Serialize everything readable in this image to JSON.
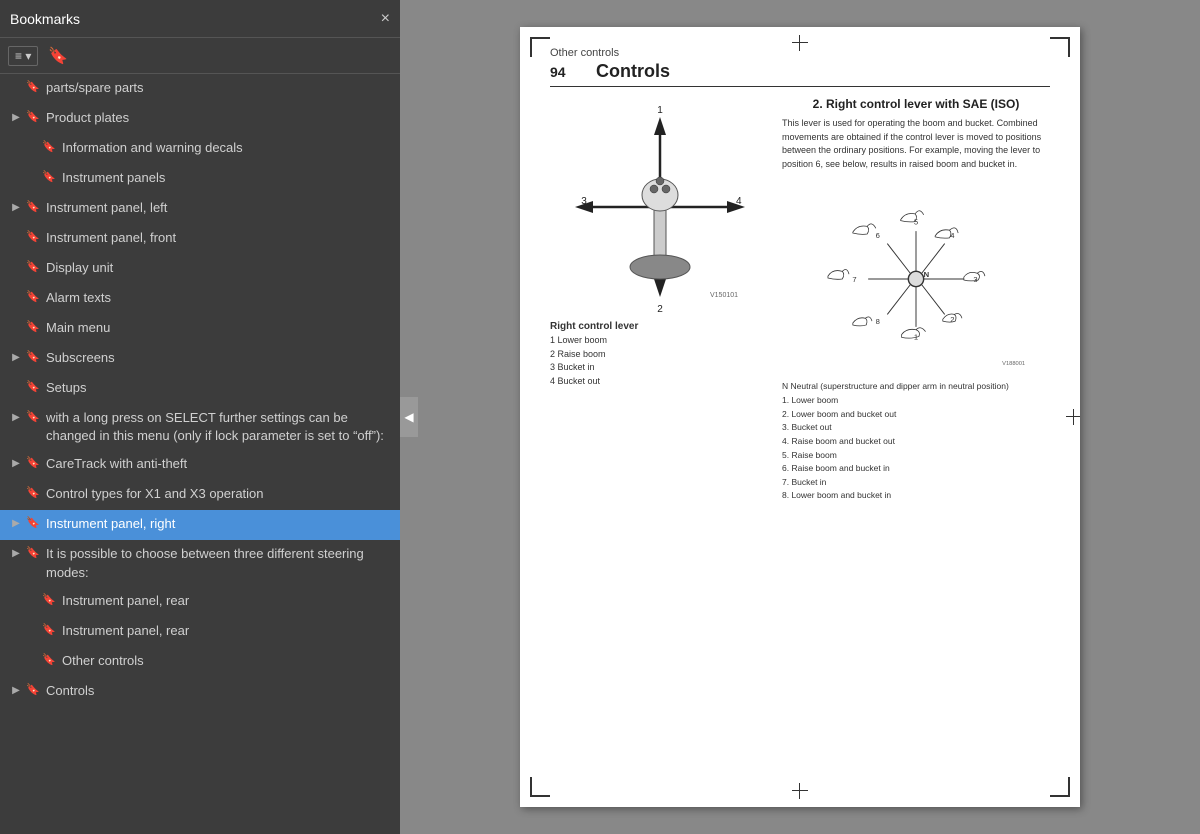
{
  "bookmarks": {
    "title": "Bookmarks",
    "close_label": "×",
    "toolbar": {
      "view_btn": "≡ ▾",
      "bookmark_btn": "🔖"
    },
    "items": [
      {
        "id": 1,
        "label": "parts/spare parts",
        "indent": 0,
        "hasChevron": false,
        "chevronOpen": false,
        "selected": false
      },
      {
        "id": 2,
        "label": "Product plates",
        "indent": 0,
        "hasChevron": true,
        "chevronOpen": false,
        "selected": false
      },
      {
        "id": 3,
        "label": "Information and warning decals",
        "indent": 1,
        "hasChevron": false,
        "chevronOpen": false,
        "selected": false
      },
      {
        "id": 4,
        "label": "Instrument panels",
        "indent": 1,
        "hasChevron": false,
        "chevronOpen": false,
        "selected": false
      },
      {
        "id": 5,
        "label": "Instrument panel, left",
        "indent": 0,
        "hasChevron": true,
        "chevronOpen": false,
        "selected": false
      },
      {
        "id": 6,
        "label": "Instrument panel, front",
        "indent": 0,
        "hasChevron": false,
        "chevronOpen": false,
        "selected": false
      },
      {
        "id": 7,
        "label": "Display unit",
        "indent": 0,
        "hasChevron": false,
        "chevronOpen": false,
        "selected": false
      },
      {
        "id": 8,
        "label": "Alarm texts",
        "indent": 0,
        "hasChevron": false,
        "chevronOpen": false,
        "selected": false
      },
      {
        "id": 9,
        "label": "Main menu",
        "indent": 0,
        "hasChevron": false,
        "chevronOpen": false,
        "selected": false
      },
      {
        "id": 10,
        "label": "Subscreens",
        "indent": 0,
        "hasChevron": true,
        "chevronOpen": false,
        "selected": false
      },
      {
        "id": 11,
        "label": "Setups",
        "indent": 0,
        "hasChevron": false,
        "chevronOpen": false,
        "selected": false
      },
      {
        "id": 12,
        "label": "with a long press on SELECT further settings can be changed in this menu (only if lock parameter is set to “off”):",
        "indent": 0,
        "hasChevron": true,
        "chevronOpen": false,
        "selected": false
      },
      {
        "id": 13,
        "label": "CareTrack with anti-theft",
        "indent": 0,
        "hasChevron": true,
        "chevronOpen": false,
        "selected": false
      },
      {
        "id": 14,
        "label": "Control types for X1 and X3 operation",
        "indent": 0,
        "hasChevron": false,
        "chevronOpen": false,
        "selected": false
      },
      {
        "id": 15,
        "label": "Instrument panel, right",
        "indent": 0,
        "hasChevron": true,
        "chevronOpen": false,
        "selected": true
      },
      {
        "id": 16,
        "label": "It is possible to choose between three different steering modes:",
        "indent": 0,
        "hasChevron": true,
        "chevronOpen": false,
        "selected": false
      },
      {
        "id": 17,
        "label": "Instrument panel, rear",
        "indent": 1,
        "hasChevron": false,
        "chevronOpen": false,
        "selected": false
      },
      {
        "id": 18,
        "label": "Instrument panel, rear",
        "indent": 1,
        "hasChevron": false,
        "chevronOpen": false,
        "selected": false
      },
      {
        "id": 19,
        "label": "Other controls",
        "indent": 1,
        "hasChevron": false,
        "chevronOpen": false,
        "selected": false
      },
      {
        "id": 20,
        "label": "Controls",
        "indent": 0,
        "hasChevron": true,
        "chevronOpen": false,
        "selected": false
      }
    ]
  },
  "pdf": {
    "page_section": "Other controls",
    "page_number": "94",
    "page_title": "Controls",
    "right_lever_title": "2. Right control lever with SAE (ISO)",
    "right_lever_description": "This lever is used for operating the boom and bucket. Combined movements are obtained if the control lever is moved to positions between the ordinary positions. For example, moving the lever to position 6, see below, results in raised boom and bucket in.",
    "lever_caption_title": "Right control lever",
    "lever_items": [
      "1  Lower boom",
      "2  Raise boom",
      "3  Bucket in",
      "4  Bucket out"
    ],
    "positions_label": "N Neutral (superstructure and dipper arm in neutral position)",
    "positions_items": [
      "1. Lower boom",
      "2. Lower boom and bucket out",
      "3. Bucket out",
      "4. Raise boom and bucket out",
      "5. Raise boom",
      "6. Raise boom and bucket in",
      "7. Bucket in",
      "8. Lower boom and bucket in"
    ]
  }
}
